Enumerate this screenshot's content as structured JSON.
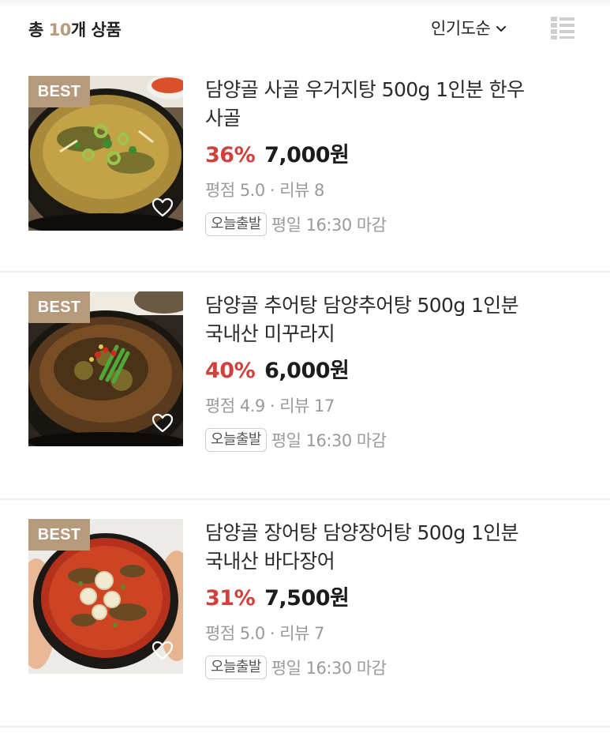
{
  "header": {
    "count_prefix": "총 ",
    "count_value": "10",
    "count_suffix": "개 상품",
    "sort_label": "인기도순",
    "sort_icon": "chevron-down-icon",
    "view_icon": "list-view-icon"
  },
  "colors": {
    "accent": "#b89b7b",
    "best_badge": "#b59a7c",
    "discount": "#d0403c",
    "muted_text": "#9a9a9a"
  },
  "products": [
    {
      "badge": "BEST",
      "title": "담양골 사골 우거지탕 500g 1인분 한우 사골",
      "discount": "36%",
      "price": "7,000원",
      "rating": "평점 5.0 · 리뷰 8",
      "shipping_badge": "오늘출발",
      "shipping_text": "평일 16:30 마감",
      "wishlist_icon": "heart-icon"
    },
    {
      "badge": "BEST",
      "title": "담양골 추어탕 담양추어탕 500g 1인분 국내산 미꾸라지",
      "discount": "40%",
      "price": "6,000원",
      "rating": "평점 4.9 · 리뷰 17",
      "shipping_badge": "오늘출발",
      "shipping_text": "평일 16:30 마감",
      "wishlist_icon": "heart-icon"
    },
    {
      "badge": "BEST",
      "title": "담양골 장어탕 담양장어탕 500g 1인분 국내산 바다장어",
      "discount": "31%",
      "price": "7,500원",
      "rating": "평점 5.0 · 리뷰 7",
      "shipping_badge": "오늘출발",
      "shipping_text": "평일 16:30 마감",
      "wishlist_icon": "heart-icon"
    }
  ]
}
